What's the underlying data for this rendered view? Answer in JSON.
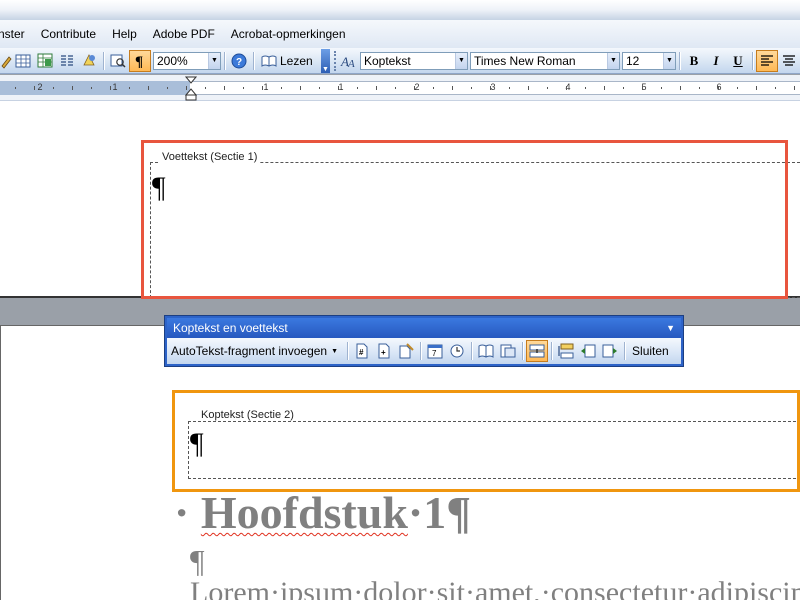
{
  "menu": {
    "items": [
      "nster",
      "Contribute",
      "Help",
      "Adobe PDF",
      "Acrobat-opmerkingen"
    ]
  },
  "toolbar": {
    "zoom": "200%",
    "read_label": "Lezen",
    "style": "Koptekst",
    "font": "Times New Roman",
    "size": "12",
    "bold": "B",
    "italic": "I",
    "underline": "U"
  },
  "ruler": {
    "labels": [
      "2",
      "1",
      "1",
      "1",
      "2",
      "3",
      "4",
      "5",
      "6",
      "7",
      "8"
    ]
  },
  "page1": {
    "footer_label": "Voettekst (Sectie 1)",
    "footer_mark": "¶"
  },
  "hf_toolbar": {
    "title": "Koptekst en voettekst",
    "autotext": "AutoTekst-fragment invoegen",
    "close": "Sluiten"
  },
  "page2": {
    "header_label": "Koptekst (Sectie 2)",
    "header_mark": "¶",
    "heading_dot": "·",
    "heading_word": "Hoofdstuk",
    "heading_rest": "·1¶",
    "empty_para": "¶",
    "body_text": "Lorem·ipsum·dolor·sit·amet,·consectetur·adipiscing"
  },
  "highlights": {
    "footer_color": "#e8553e",
    "header_color": "#f0960f"
  }
}
